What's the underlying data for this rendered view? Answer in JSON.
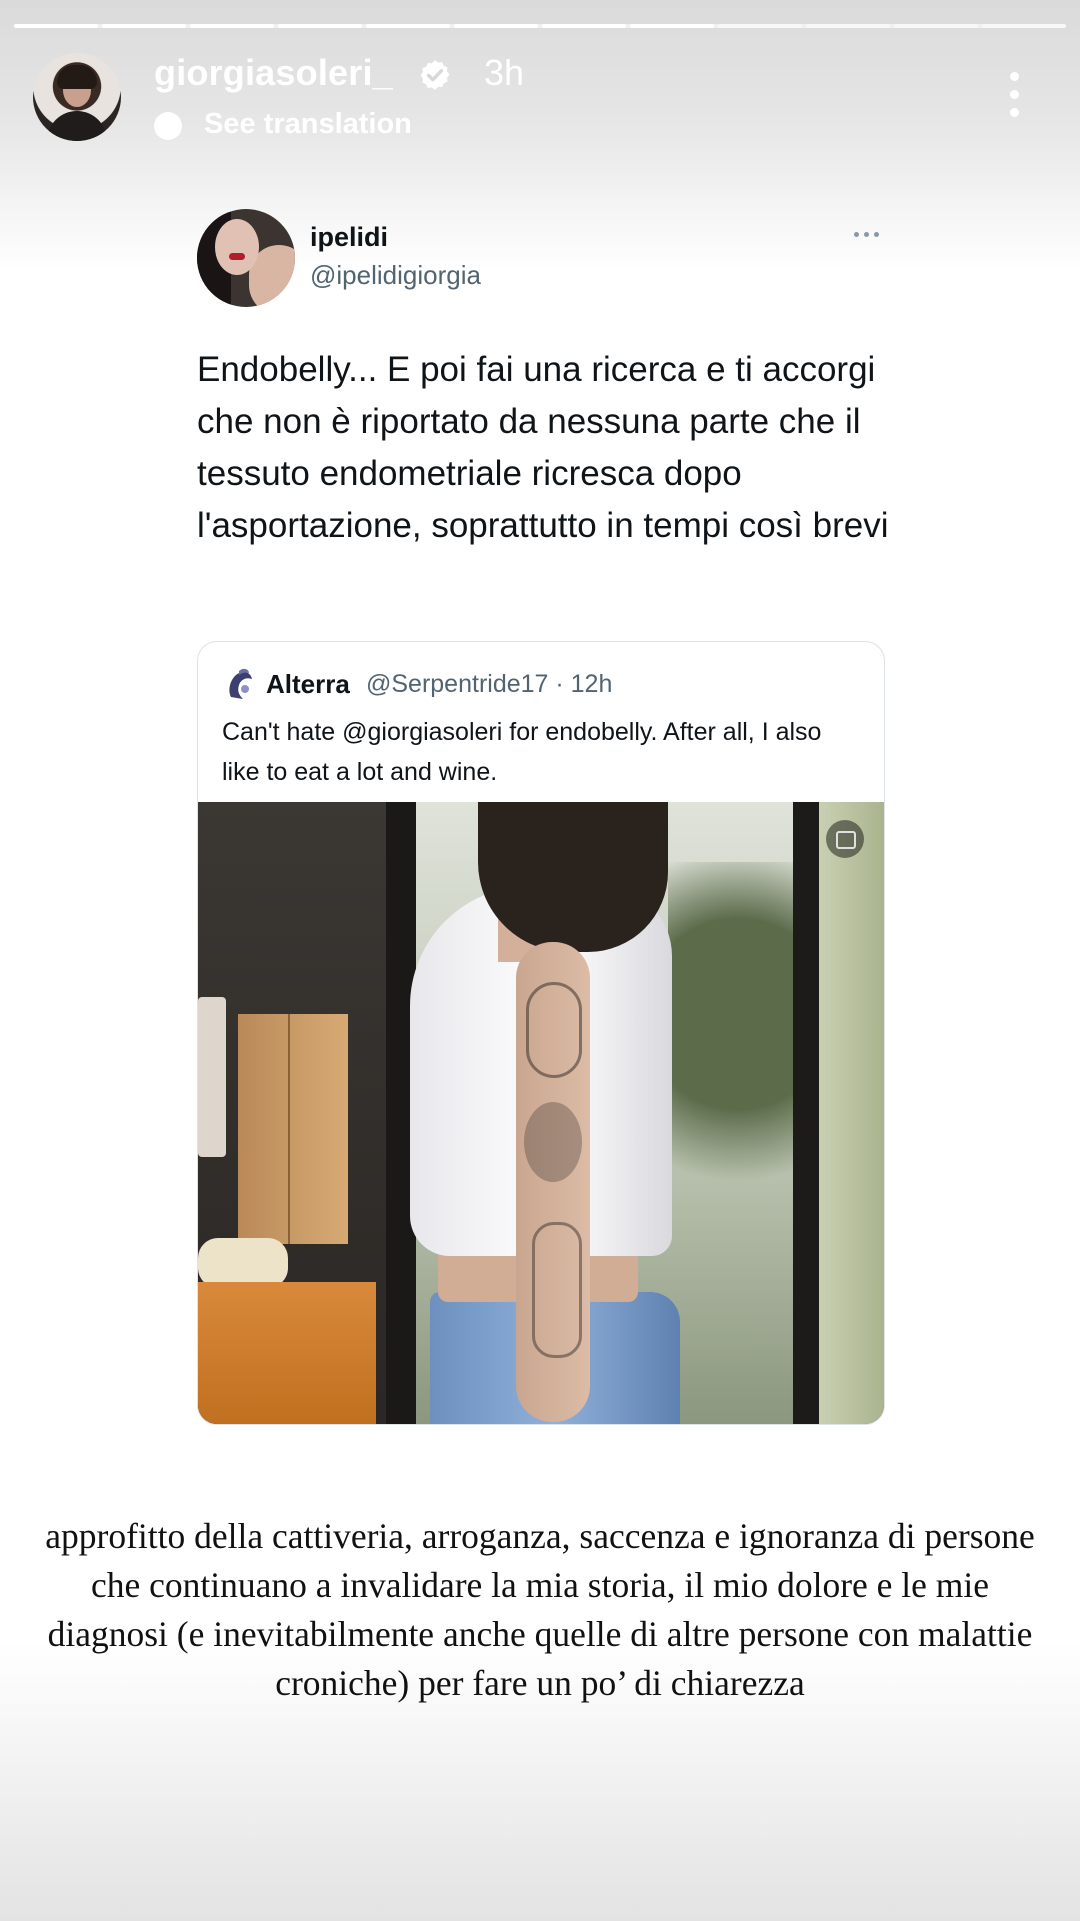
{
  "story": {
    "progress_segments": 12,
    "progress_filled": 8
  },
  "header": {
    "username": "giorgiasoleri_",
    "verified_icon": "verified-badge-icon",
    "timestamp": "3h",
    "translation_label": "See translation",
    "more_icon": "more-vertical-icon"
  },
  "tweet": {
    "display_name": "ipelidi",
    "handle": "@ipelidigiorgia",
    "text": "Endobelly... E poi fai una ricerca e ti accorgi che non è riportato da nessuna parte che il tessuto endometriale ricresca dopo l'asportazione, soprattutto in tempi così brevi",
    "quoted": {
      "display_name": "Alterra",
      "meta": "@Serpentride17 · 12h",
      "text": "Can't hate @giorgiasoleri for endobelly.  After all, I also like to eat a lot and wine."
    }
  },
  "caption": "approfitto della cattiveria, arroganza, saccenza e ignoranza di persone che continuano a invalidare la mia storia, il mio dolore e le mie diagnosi (e inevitabilmente anche quelle di altre persone con malattie croniche) per fare un po’ di chiarezza",
  "colors": {
    "text_primary": "#0f1419",
    "text_secondary": "#536471",
    "verified_badge": "#ffffff"
  }
}
